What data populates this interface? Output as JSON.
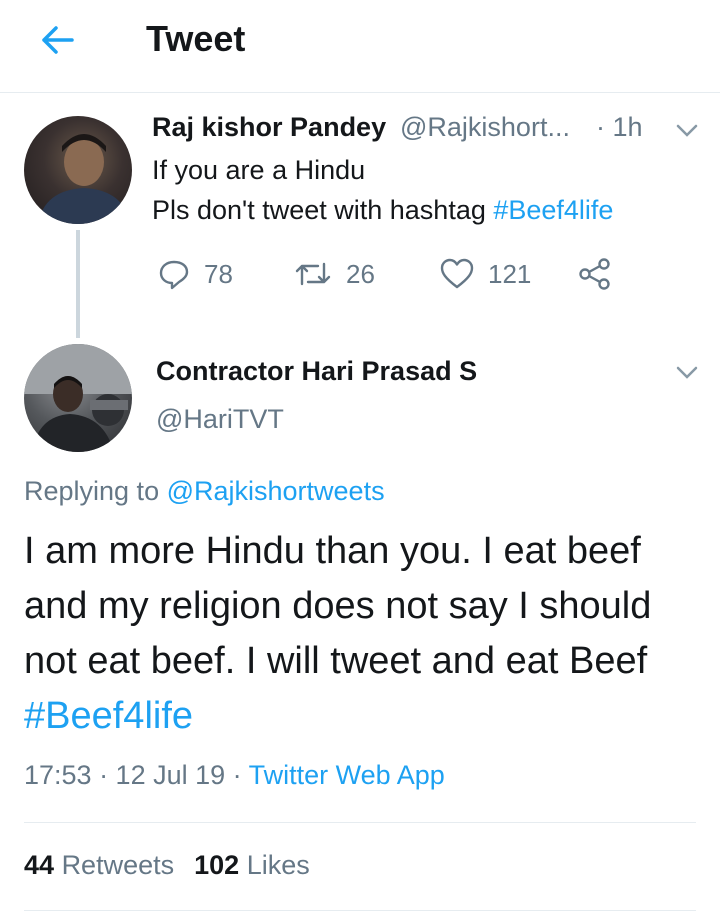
{
  "header": {
    "title": "Tweet"
  },
  "parent_tweet": {
    "name": "Raj kishor Pandey",
    "handle": "@Rajkishort...",
    "time": "· 1h",
    "line1": "If you are a Hindu",
    "line2_prefix": "Pls don't tweet with hashtag ",
    "hashtag": "#Beef4life",
    "replies": "78",
    "retweets": "26",
    "likes": "121"
  },
  "main_tweet": {
    "name": "Contractor Hari Prasad S",
    "handle": "@HariTVT",
    "replying_prefix": "Replying to ",
    "replying_handle": "@Rajkishortweets",
    "text": "I am more Hindu than you. I eat beef and my religion does not say I should not eat beef. I will tweet and eat Beef ",
    "hashtag": "#Beef4life",
    "time": "17:53 · 12 Jul 19 · ",
    "source": "Twitter Web App",
    "retweets_count": "44",
    "retweets_label": "Retweets",
    "likes_count": "102",
    "likes_label": "Likes"
  },
  "icons": {
    "back": "arrow-left-icon",
    "menu": "chevron-down-icon",
    "reply": "reply-icon",
    "retweet": "retweet-icon",
    "like": "heart-icon",
    "share": "share-icon"
  },
  "colors": {
    "accent": "#1da1f2",
    "text": "#14171a",
    "muted": "#657786",
    "divider": "#e6ecf0"
  }
}
